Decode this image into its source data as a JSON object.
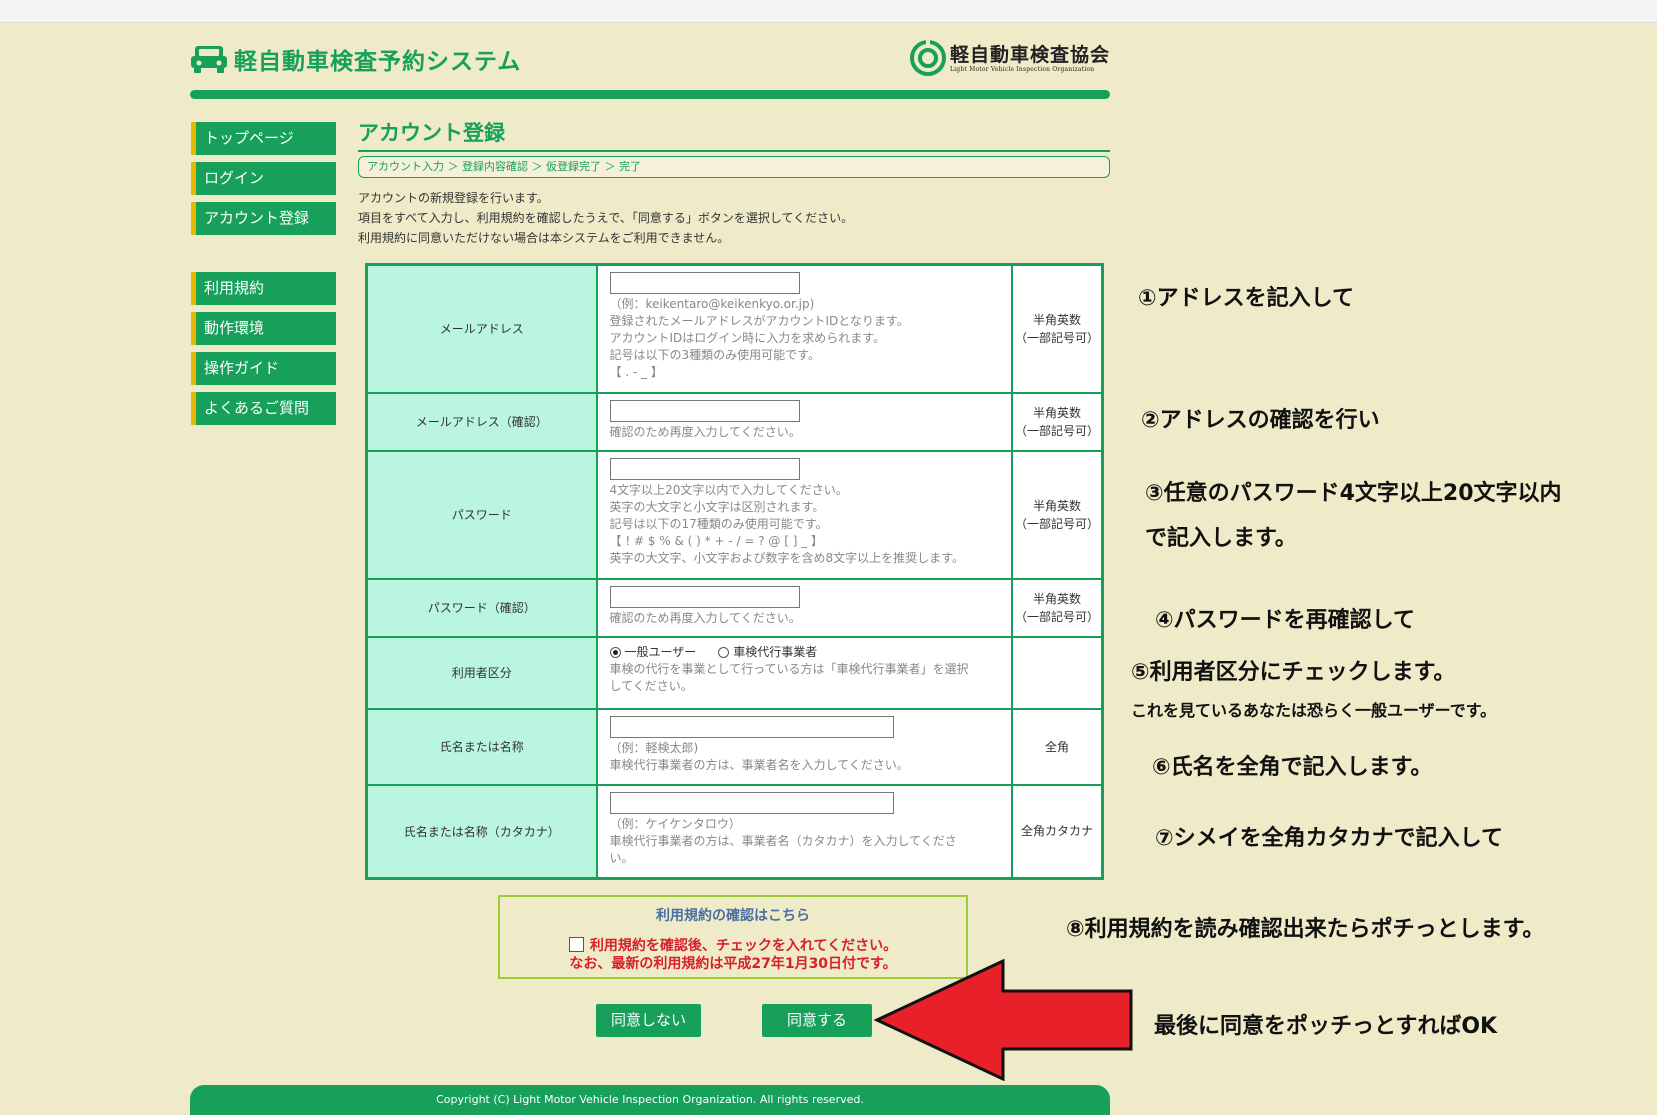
{
  "header": {
    "system_title": "軽自動車検査予約システム",
    "org_name": "軽自動車検査協会",
    "org_subtitle": "Light Motor Vehicle Inspection Organization"
  },
  "sidebar": {
    "items": [
      {
        "label": "トップページ"
      },
      {
        "label": "ログイン"
      },
      {
        "label": "アカウント登録"
      },
      {
        "label": "利用規約"
      },
      {
        "label": "動作環境"
      },
      {
        "label": "操作ガイド"
      },
      {
        "label": "よくあるご質問"
      }
    ]
  },
  "main": {
    "title": "アカウント登録",
    "breadcrumb": "アカウント入力 ＞ 登録内容確認 ＞ 仮登録完了 ＞ 完了",
    "intro": [
      "アカウントの新規登録を行います。",
      "項目をすべて入力し、利用規約を確認したうえで、「同意する」ボタンを選択してください。",
      "利用規約に同意いただけない場合は本システムをご利用できません。"
    ]
  },
  "form": {
    "email": {
      "label": "メールアドレス",
      "value": "",
      "help": [
        "（例：keikentaro@keikenkyo.or.jp)",
        "登録されたメールアドレスがアカウントIDとなります。",
        "アカウントIDはログイン時に入力を求められます。",
        "記号は以下の3種類のみ使用可能です。",
        "【 . - _ 】"
      ],
      "type": [
        "半角英数",
        "（一部記号可）"
      ]
    },
    "email_confirm": {
      "label": "メールアドレス（確認）",
      "value": "",
      "help": [
        "確認のため再度入力してください。"
      ],
      "type": [
        "半角英数",
        "（一部記号可）"
      ]
    },
    "password": {
      "label": "パスワード",
      "value": "",
      "help": [
        "4文字以上20文字以内で入力してください。",
        "英字の大文字と小文字は区別されます。",
        "記号は以下の17種類のみ使用可能です。",
        "【 ! # $ % & ( ) * + - / = ? @ [ ] _ 】",
        "英字の大文字、小文字および数字を含め8文字以上を推奨します。"
      ],
      "type": [
        "半角英数",
        "（一部記号可）"
      ]
    },
    "password_confirm": {
      "label": "パスワード（確認）",
      "value": "",
      "help": [
        "確認のため再度入力してください。"
      ],
      "type": [
        "半角英数",
        "（一部記号可）"
      ]
    },
    "user_type": {
      "label": "利用者区分",
      "options": [
        "一般ユーザー",
        "車検代行事業者"
      ],
      "selected": "一般ユーザー",
      "help": [
        "車検の代行を事業として行っている方は「車検代行事業者」を選択",
        "してください。"
      ]
    },
    "name": {
      "label": "氏名または名称",
      "value": "",
      "help": [
        "（例：軽検太郎)",
        "車検代行事業者の方は、事業者名を入力してください。"
      ],
      "type": "全角"
    },
    "name_kana": {
      "label": "氏名または名称（カタカナ）",
      "value": "",
      "help": [
        "（例：ケイケンタロウ）",
        "車検代行事業者の方は、事業者名（カタカナ）を入力してくださ",
        "い。"
      ],
      "type": "全角カタカナ"
    }
  },
  "terms": {
    "link": "利用規約の確認はこちら",
    "checkbox_label": "利用規約を確認後、チェックを入れてください。",
    "notice": "なお、最新の利用規約は平成27年1月30日付です。",
    "checked": false
  },
  "buttons": {
    "disagree": "同意しない",
    "agree": "同意する"
  },
  "footer": {
    "copyright": "Copyright (C) Light Motor Vehicle Inspection Organization. All rights reserved."
  },
  "annotations": {
    "n1": "①アドレスを記入して",
    "n2": "②アドレスの確認を行い",
    "n3a": "③任意のパスワード4文字以上20文字以内",
    "n3b": "で記入します。",
    "n4": "④パスワードを再確認して",
    "n5": "⑤利用者区分にチェックします。",
    "n5b": "これを見ているあなたは恐らく一般ユーザーです。",
    "n6": "⑥氏名を全角で記入します。",
    "n7": "⑦シメイを全角カタカナで記入して",
    "n8": "⑧利用規約を読み確認出来たらポチっとします。",
    "n9": "最後に同意をポッチっとすればOK"
  },
  "colors": {
    "brand_green": "#16a05a",
    "label_bg": "#b9f5df",
    "page_bg": "#efebc9",
    "arrow_red": "#e8202a",
    "notice_red": "#d8202a",
    "side_accent": "#e8b800"
  },
  "icons": [
    "car-icon",
    "org-logo-icon",
    "red-arrow-icon"
  ]
}
